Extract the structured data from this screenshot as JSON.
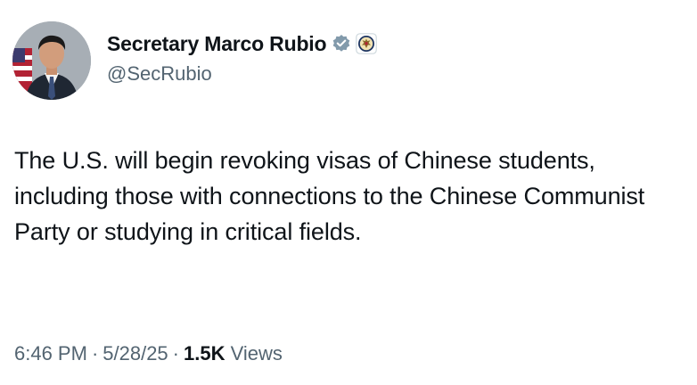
{
  "author": {
    "display_name": "Secretary Marco Rubio",
    "handle": "@SecRubio"
  },
  "badges": {
    "verified_icon": "verified-badge-icon",
    "affiliate_icon": "state-department-seal-icon",
    "verified_color": "#829aab"
  },
  "tweet": {
    "text": "The U.S. will begin revoking visas of Chinese students, including those with connections to the Chinese Communist Party or studying in critical fields."
  },
  "meta": {
    "time": "6:46 PM",
    "separator": "·",
    "date": "5/28/25",
    "views_count": "1.5K",
    "views_label": "Views"
  }
}
